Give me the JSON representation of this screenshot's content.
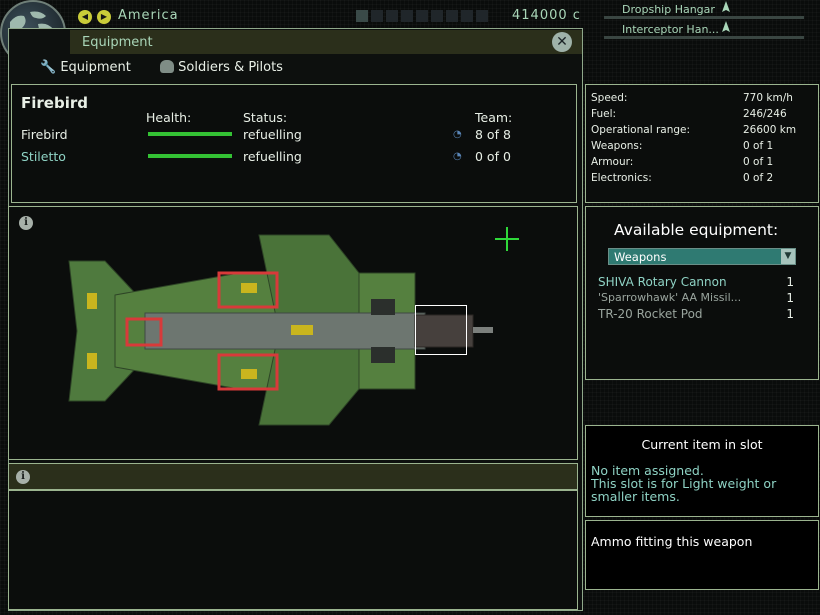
{
  "topbar": {
    "base_name": "America",
    "credits": "414000 c"
  },
  "hangars": [
    {
      "label": "Dropship Hangar"
    },
    {
      "label": "Interceptor Han..."
    }
  ],
  "equipment_panel": {
    "title": "Equipment",
    "tabs": [
      {
        "label": "Equipment",
        "icon": "wrench-icon"
      },
      {
        "label": "Soldiers & Pilots",
        "icon": "helmet-icon"
      }
    ]
  },
  "team": {
    "craft_name": "Firebird",
    "headers": {
      "health": "Health:",
      "status": "Status:",
      "team": "Team:"
    },
    "rows": [
      {
        "name": "Firebird",
        "health": 1.0,
        "status": "refuelling",
        "team": "8 of 8",
        "name_color": "#e8efe6"
      },
      {
        "name": "Stiletto",
        "health": 1.0,
        "status": "refuelling",
        "team": "0 of 0",
        "name_color": "#8fd3c5"
      }
    ]
  },
  "stats": [
    {
      "label": "Speed:",
      "value": "770 km/h"
    },
    {
      "label": "Fuel:",
      "value": "246/246"
    },
    {
      "label": "Operational range:",
      "value": "26600 km"
    },
    {
      "label": "Weapons:",
      "value": "0 of 1"
    },
    {
      "label": "Armour:",
      "value": "0 of 1"
    },
    {
      "label": "Electronics:",
      "value": "0 of 2"
    }
  ],
  "available": {
    "title": "Available equipment:",
    "category": "Weapons",
    "items": [
      {
        "name": "SHIVA Rotary Cannon",
        "qty": "1",
        "color": "#8fd3c5"
      },
      {
        "name": "'Sparrowhawk' AA Missil...",
        "qty": "1",
        "color": "#9aa59e"
      },
      {
        "name": "TR-20 Rocket Pod",
        "qty": "1",
        "color": "#9aa59e"
      }
    ]
  },
  "slot": {
    "title": "Current item in slot",
    "line1": "No item assigned.",
    "line2": "This slot is for Light weight or",
    "line3": "smaller items."
  },
  "ammo": {
    "title": "Ammo fitting this weapon"
  },
  "colors": {
    "accent": "#a9d6b8",
    "health_bar": "#34c234",
    "panel_border": "#8fa88a",
    "select_bg": "#2f7a72",
    "hull_green": "#4f7a3e"
  }
}
